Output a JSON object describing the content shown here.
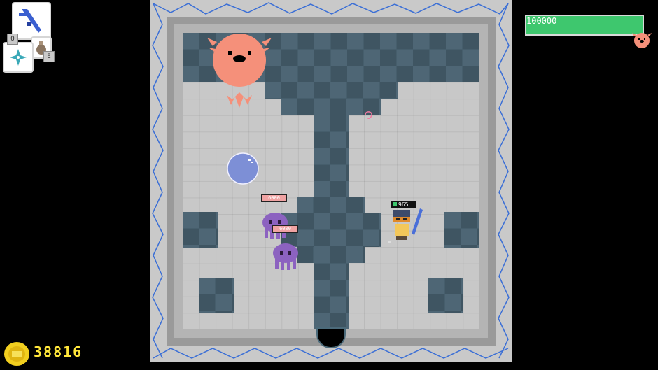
{
  "hud": {
    "boss_hp": "100000",
    "boss_icon": "pink-pufferfish-icon",
    "coins": "38816",
    "coin_icon": "gold-coin-icon",
    "weapon_primary_icon": "blue-sword-icon",
    "weapon_secondary_icon": "potion-flask-icon",
    "weapon_tertiary_icon": "shuriken-icon",
    "key_q": "Q",
    "key_e": "E"
  },
  "entities": {
    "enemy_1_hp": "6000",
    "enemy_2_hp": "6000",
    "player_hp": "965"
  },
  "colors": {
    "boss_bar": "#3ec76e",
    "coin_text": "#ffe63a",
    "boss_pink": "#f5907a",
    "enemy_purple": "#8c62c0",
    "water_orb": "#7d8fd6",
    "dark_tile": "#4e6675",
    "light_tile": "#c8c8c8"
  }
}
